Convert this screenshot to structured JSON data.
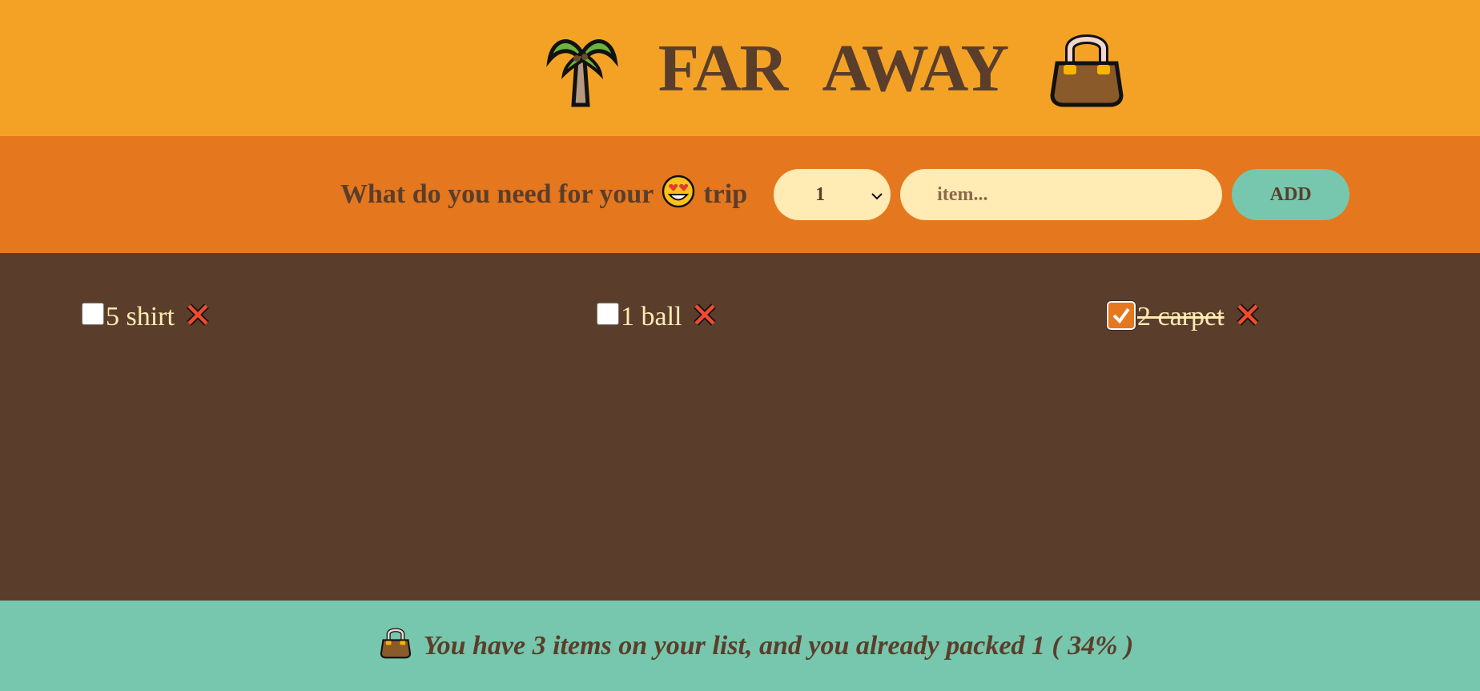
{
  "header": {
    "title": "FAR AWAY",
    "left_icon": "palm-tree-icon",
    "right_icon": "handbag-icon"
  },
  "form": {
    "prompt_before": "What do you need for your",
    "prompt_emoji": "heart-eyes-face-icon",
    "prompt_after": "trip",
    "quantity_value": "1",
    "item_placeholder": "item...",
    "add_label": "ADD"
  },
  "items": [
    {
      "text": "5 shirt",
      "packed": false
    },
    {
      "text": "1 ball",
      "packed": false
    },
    {
      "text": "2 carpet",
      "packed": true
    }
  ],
  "stats": {
    "icon": "handbag-icon",
    "text": "You have 3 items on your list, and you already packed 1 ( 34% )"
  },
  "colors": {
    "header_bg": "#f4a226",
    "form_bg": "#e5771e",
    "list_bg": "#5a3e2b",
    "stats_bg": "#76c7ad",
    "text_light": "#ffebb3",
    "text_dark": "#5a3e2b"
  }
}
